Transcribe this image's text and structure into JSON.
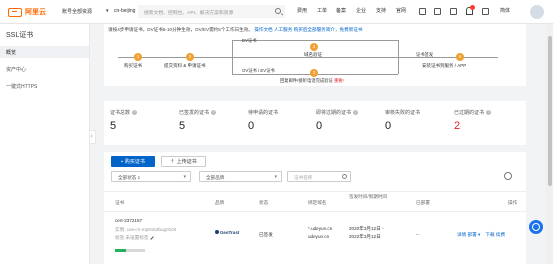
{
  "header": {
    "brand": "阿里云",
    "workspace": "账号全部资源",
    "region": "cn-beijing",
    "search_placeholder": "搜索文档、控制台、API、解决方案和资源",
    "menu": [
      "费用",
      "工单",
      "备案",
      "企业",
      "支持",
      "官网"
    ],
    "lang": "简体"
  },
  "sidebar": {
    "title": "SSL证书",
    "items": [
      {
        "label": "概览",
        "active": true
      },
      {
        "label": "资产中心",
        "active": false
      },
      {
        "label": "一键式HTTPS",
        "active": false
      }
    ]
  },
  "flow": {
    "intro": "请按4步申请证书，DV证书5-10分钟生效，OV/EV需约5个工作日生效。",
    "links": [
      "操作文档",
      "人工服务",
      "购买后全部服务简介，免费新证书"
    ],
    "steps": [
      {
        "num": "1",
        "label": "购买证书"
      },
      {
        "num": "2",
        "label": "提交资料 & 申请证书"
      },
      {
        "num": "3",
        "label": "域名验证"
      },
      {
        "num": "4",
        "label": "安装证书到服务 / APP"
      }
    ],
    "dv_label": "DV证书",
    "ov_ev_label": "OV证书 / EV证书",
    "issue_label": "证书签发",
    "ov_note": "回复邮件/接听电话完成验证",
    "ov_note_highlight": "重要!",
    "accent_color": "#f0a030"
  },
  "stats": [
    {
      "label": "证书总数",
      "value": "5",
      "red": false
    },
    {
      "label": "已签发的证书",
      "value": "5",
      "red": false
    },
    {
      "label": "待申请的证书",
      "value": "0",
      "red": false
    },
    {
      "label": "即将过期的证书",
      "value": "0",
      "red": false
    },
    {
      "label": "审核失败的证书",
      "value": "0",
      "red": false
    },
    {
      "label": "已过期的证书",
      "value": "2",
      "red": true
    }
  ],
  "list": {
    "buy_button": "购买证书",
    "upload_button": "上传证书",
    "filter_status": "全部状态",
    "filter_status_count": "1",
    "filter_brand": "全部品牌",
    "search_placeholder": "证书名称",
    "columns": [
      "证书",
      "品牌",
      "状态",
      "绑定域名",
      "签发时间/到期时间",
      "已部署",
      "操作"
    ],
    "row": {
      "name": "cert-2372157",
      "id": "实例: cas-cn-mp9153bug0104",
      "note": "标签:未设置标签",
      "brand": "GeoTrust",
      "status": "已签发",
      "domains": [
        "*.udeyun.cn",
        "udeyun.cn"
      ],
      "dates": [
        "2020年3月12日 -",
        "2022年3月12日"
      ],
      "deployed": "--",
      "actions": [
        "详情",
        "部署",
        "下载",
        "续费"
      ],
      "progress_percent": 35
    }
  },
  "colors": {
    "brand": "#ff6a00",
    "primary": "#0064c8",
    "danger": "#e02020",
    "success": "#26b05c"
  }
}
